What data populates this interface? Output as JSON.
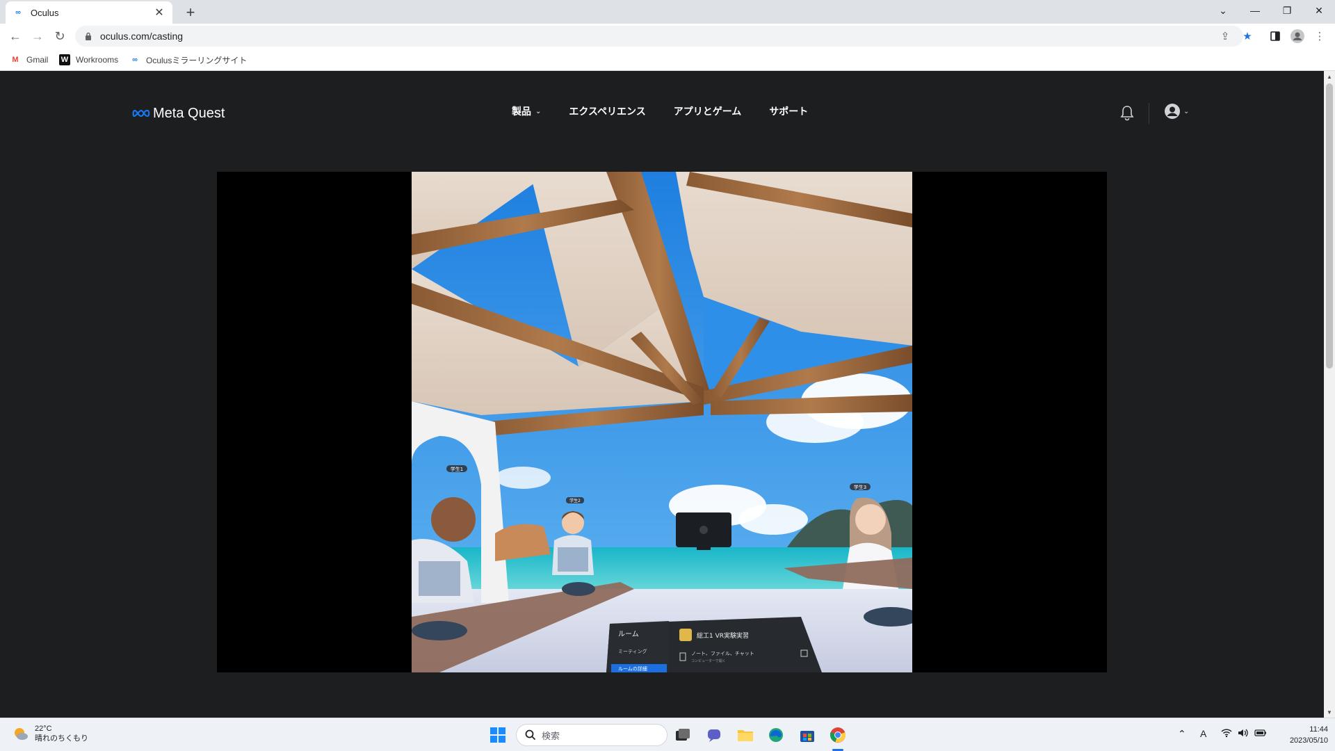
{
  "browser": {
    "tab": {
      "title": "Oculus",
      "favicon": "meta-infinity-icon"
    },
    "address": {
      "url": "oculus.com/casting"
    },
    "bookmarks": [
      {
        "label": "Gmail",
        "icon": "gmail-icon"
      },
      {
        "label": "Workrooms",
        "icon": "workrooms-icon"
      },
      {
        "label": "Oculusミラーリングサイト",
        "icon": "meta-infinity-icon"
      }
    ]
  },
  "site": {
    "logo": "Meta Quest",
    "nav": [
      {
        "label": "製品",
        "has_dropdown": true
      },
      {
        "label": "エクスペリエンス",
        "has_dropdown": false
      },
      {
        "label": "アプリとゲーム",
        "has_dropdown": false
      },
      {
        "label": "サポート",
        "has_dropdown": false
      }
    ]
  },
  "vr_scene": {
    "avatars": [
      {
        "tag": "学生1"
      },
      {
        "tag": "学生2"
      },
      {
        "tag": "学生3"
      }
    ],
    "panel": {
      "menu": [
        "ルーム",
        "ミーティング",
        "ルームの詳細"
      ],
      "room_name": "総工1  VR実験実習",
      "row_title": "ノート、ファイル、チャット",
      "row_sub": "コンピューターで開く"
    }
  },
  "taskbar": {
    "weather": {
      "temp": "22°C",
      "desc": "晴れのちくもり"
    },
    "search_placeholder": "検索",
    "clock": {
      "time": "11:44",
      "date": "2023/05/10"
    },
    "ime": "A"
  },
  "colors": {
    "page_bg": "#1c1e20",
    "meta_blue": "#1877f2",
    "chrome_bg": "#dee1e6"
  }
}
